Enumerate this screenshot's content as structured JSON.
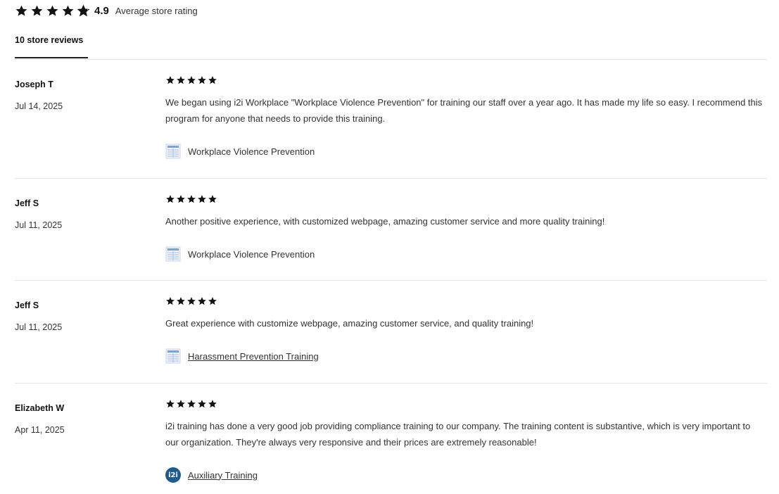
{
  "summary": {
    "average_rating": 4.9,
    "rating_text": "4.9",
    "rating_label": "Average store rating",
    "star_icons": [
      "star-full-icon",
      "star-full-icon",
      "star-full-icon",
      "star-full-icon",
      "star-partial-icon"
    ]
  },
  "tabs": [
    {
      "label": "10 store reviews",
      "active": true
    }
  ],
  "colors": {
    "star": "#111111",
    "divider": "#e3e3e3",
    "logo_blue": "#1f5c8c"
  },
  "reviews": [
    {
      "author": "Joseph T",
      "date": "Jul 14, 2025",
      "rating": 5,
      "text": "We began using i2i Workplace \"Workplace Violence Prevention\" for training our staff over a year ago. It has made my life so easy. I recommend this program for anyone that needs to provide this training.",
      "product": "Workplace Violence Prevention",
      "product_icon": "document-thumbnail-icon"
    },
    {
      "author": "Jeff S",
      "date": "Jul 11, 2025",
      "rating": 5,
      "text": "Another positive experience, with customized webpage, amazing customer service and more quality training!",
      "product": "Workplace Violence Prevention",
      "product_icon": "document-thumbnail-icon"
    },
    {
      "author": "Jeff S",
      "date": "Jul 11, 2025",
      "rating": 5,
      "text": "Great experience with customize webpage, amazing customer service, and quality training!",
      "product": "Harassment Prevention Training",
      "product_icon": "document-thumbnail-icon"
    },
    {
      "author": "Elizabeth W",
      "date": "Apr 11, 2025",
      "rating": 5,
      "text": "i2i training has done a very good job providing compliance training to our company. The training content is substantive, which is very important to our organization. They're always very responsive and their prices are extremely reasonable!",
      "product": "Auxiliary Training",
      "product_icon": "i2i-logo-icon",
      "product_logo_text": "i2i"
    }
  ]
}
